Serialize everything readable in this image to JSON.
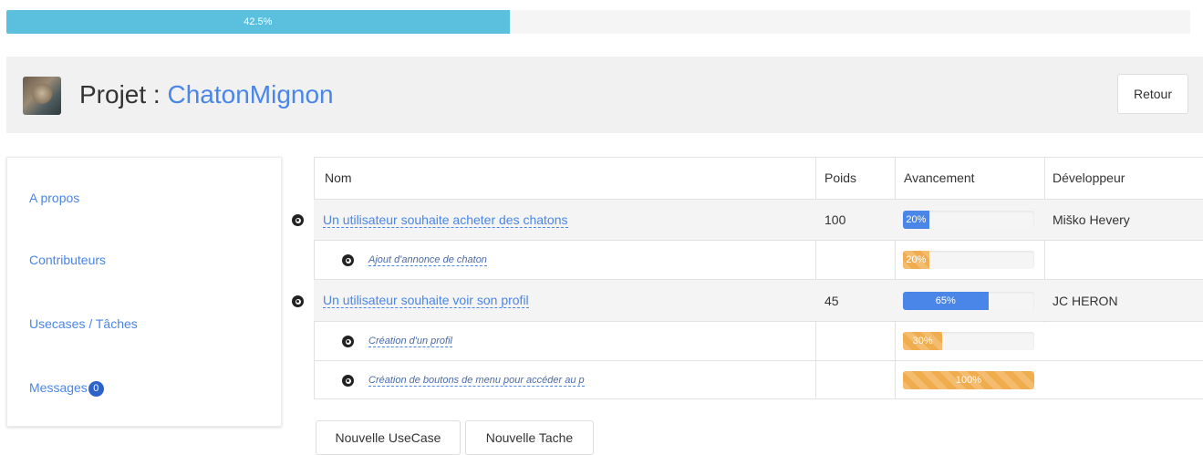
{
  "global_progress": {
    "value": 42.5,
    "label": "42.5%"
  },
  "header": {
    "title_prefix": "Projet : ",
    "project_name": "ChatonMignon",
    "back_label": "Retour"
  },
  "sidebar": {
    "items": [
      {
        "label": "A propos"
      },
      {
        "label": "Contributeurs"
      },
      {
        "label": "Usecases / Tâches"
      },
      {
        "label": "Messages",
        "badge": "0"
      }
    ]
  },
  "table": {
    "headers": {
      "name": "Nom",
      "weight": "Poids",
      "progress": "Avancement",
      "developer": "Développeur"
    },
    "rows": [
      {
        "level": "usecase",
        "name": "Un utilisateur souhaite acheter des chatons",
        "weight": "100",
        "progress": 20,
        "progress_label": "20%",
        "color": "#4a86e8",
        "developer": "Miško Hevery"
      },
      {
        "level": "task",
        "name": "Ajout d'annonce de chaton",
        "weight": "",
        "progress": 20,
        "progress_label": "20%",
        "color": "#f0ad4e",
        "developer": ""
      },
      {
        "level": "usecase",
        "name": "Un utilisateur souhaite voir son profil",
        "weight": "45",
        "progress": 65,
        "progress_label": "65%",
        "color": "#4a86e8",
        "developer": "JC HERON"
      },
      {
        "level": "task",
        "name": "Création d'un profil",
        "weight": "",
        "progress": 30,
        "progress_label": "30%",
        "color": "#f0ad4e",
        "developer": ""
      },
      {
        "level": "task",
        "name": "Création de boutons de menu pour accéder au p",
        "weight": "",
        "progress": 100,
        "progress_label": "100%",
        "color": "#f0ad4e",
        "developer": ""
      }
    ]
  },
  "actions": {
    "new_usecase": "Nouvelle UseCase",
    "new_task": "Nouvelle Tache"
  }
}
